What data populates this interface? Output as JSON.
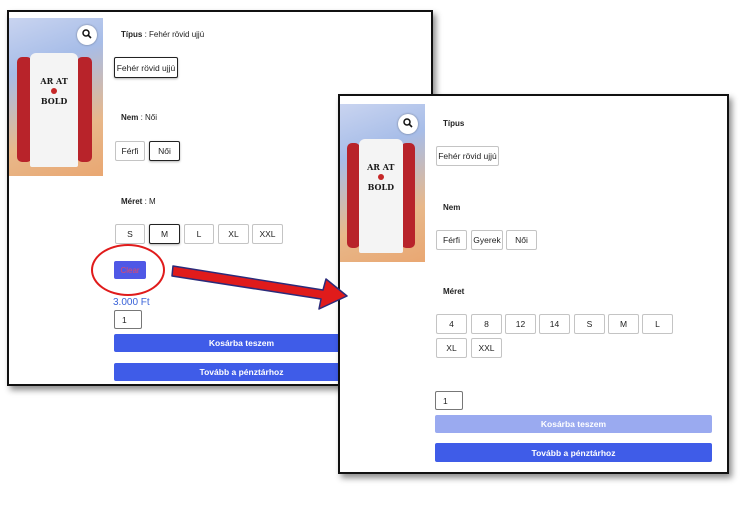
{
  "left_panel": {
    "tipus": {
      "label": "Típus",
      "value": ": Fehér rövid ujjú",
      "options": [
        "Fehér rövid ujjú"
      ]
    },
    "nem": {
      "label": "Nem",
      "value": ": Női",
      "options": [
        "Férfi",
        "Női"
      ]
    },
    "meret": {
      "label": "Méret",
      "value": ": M",
      "options": [
        "S",
        "M",
        "L",
        "XL",
        "XXL"
      ]
    },
    "clear_button": "Clear",
    "price": "3.000 Ft",
    "quantity": "1",
    "add_to_cart": "Kosárba teszem",
    "checkout": "Tovább a pénztárhoz"
  },
  "right_panel": {
    "tipus": {
      "label": "Típus",
      "options": [
        "Fehér rövid ujjú"
      ]
    },
    "nem": {
      "label": "Nem",
      "options": [
        "Férfi",
        "Gyerek",
        "Női"
      ]
    },
    "meret": {
      "label": "Méret",
      "options": [
        "4",
        "8",
        "12",
        "14",
        "S",
        "M",
        "L",
        "XL",
        "XXL"
      ]
    },
    "quantity": "1",
    "add_to_cart": "Kosárba teszem",
    "checkout": "Tovább a pénztárhoz"
  },
  "colors": {
    "primary": "#3f5ce8",
    "primary_disabled": "#9aaaf0",
    "price": "#3a63d8",
    "annotation": "#e01b1b"
  },
  "icons": {
    "zoom": "search-icon",
    "annotation_arrow": "red-arrow-icon"
  }
}
